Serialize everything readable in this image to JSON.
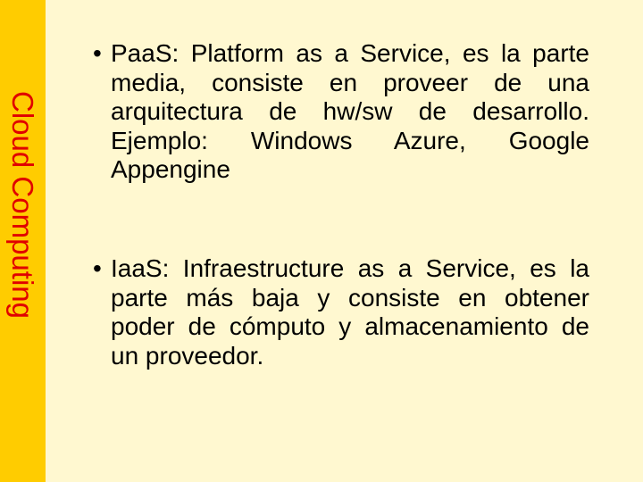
{
  "sidebar": {
    "title": "Cloud Computing",
    "colors": {
      "background": "#FFCC00",
      "title": "#E00000"
    }
  },
  "content": {
    "background": "#FFF8D0",
    "bullets": [
      {
        "marker": "•",
        "text": "PaaS: Platform as a Service, es la parte media, consiste en proveer de una arquitectura de hw/sw de desarrollo. Ejemplo: Windows Azure, Google Appengine"
      },
      {
        "marker": "•",
        "text": "IaaS: Infraestructure as a Service, es la parte más baja y consiste en obtener poder de cómputo y almacenamiento de un proveedor."
      }
    ]
  }
}
